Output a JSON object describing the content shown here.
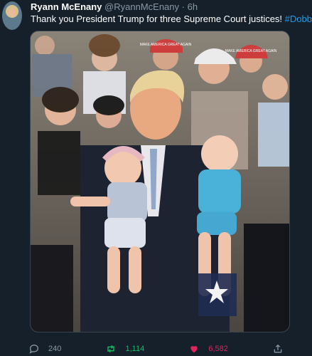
{
  "author": {
    "name": "Ryann McEnany",
    "handle": "@RyannMcEnany",
    "separator": "·",
    "time": "6h"
  },
  "tweet": {
    "text": "Thank you President Trump for three Supreme Court justices! ",
    "hashtag": "#Dobbs"
  },
  "media": {
    "caps": [
      "MAKE AMERICA GREAT AGAIN",
      "MAKE AMERICA GREAT AGAIN"
    ]
  },
  "actions": {
    "replies": "240",
    "retweets": "1,114",
    "likes": "6,582"
  },
  "colors": {
    "background": "#15202b",
    "muted": "#8899a6",
    "link": "#1d9bf0",
    "retweet": "#17bf63",
    "like": "#e0245e"
  }
}
